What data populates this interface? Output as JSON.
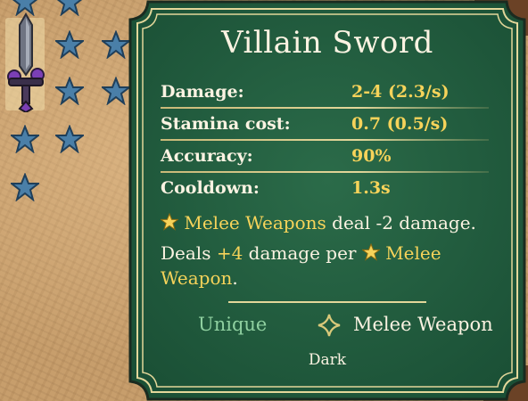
{
  "item": {
    "name": "Villain Sword",
    "stats": [
      {
        "label": "Damage:",
        "value": "2-4 (2.3/s)"
      },
      {
        "label": "Stamina cost:",
        "value": "0.7 (0.5/s)"
      },
      {
        "label": "Accuracy:",
        "value": "90%"
      },
      {
        "label": "Cooldown:",
        "value": "1.3s"
      }
    ],
    "effect1": {
      "highlight": "Melee Weapons",
      "text": " deal -2 damage."
    },
    "effect2": {
      "before": "Deals ",
      "bonus": "+4",
      "middle": " damage per ",
      "highlight": "Melee",
      "highlight2": "Weapon",
      "after": "."
    },
    "rarity": "Unique",
    "type": "Melee Weapon",
    "tag": "Dark",
    "icon": "star-icon"
  },
  "colors": {
    "card_green": "#1f5a3d",
    "border_gold": "#e3d79a",
    "highlight_yellow": "#f6d35a",
    "rarity_green": "#8fd0a0",
    "slot_star_blue": "#4a7fa8"
  }
}
